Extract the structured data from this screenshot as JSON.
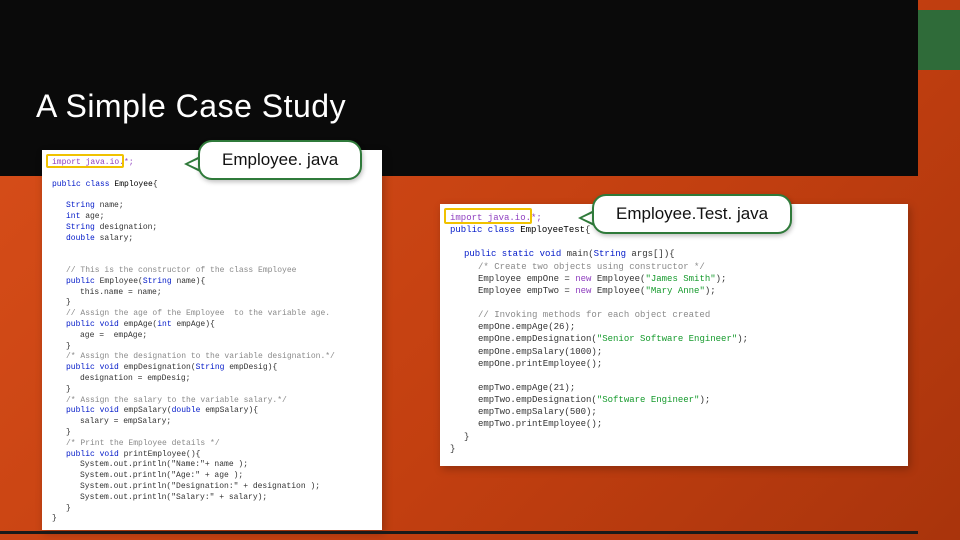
{
  "title": "A Simple Case Study",
  "callouts": {
    "left": "Employee. java",
    "right": "Employee.Test. java"
  },
  "code_left": {
    "import": "import java.io.*;",
    "class_decl": "public class Employee{",
    "fields": [
      "String name;",
      "int age;",
      "String designation;",
      "double salary;"
    ],
    "ctor_cm": "// This is the constructor of the class Employee",
    "ctor_sig": "public Employee(String name){",
    "ctor_body": "this.name = name;",
    "age_cm": "// Assign the age of the Employee  to the variable age.",
    "age_sig": "public void empAge(int empAge){",
    "age_body": "age =  empAge;",
    "desig_cm": "/* Assign the designation to the variable designation.*/",
    "desig_sig": "public void empDesignation(String empDesig){",
    "desig_body": "designation = empDesig;",
    "sal_cm": "/* Assign the salary to the variable salary.*/",
    "sal_sig": "public void empSalary(double empSalary){",
    "sal_body": "salary = empSalary;",
    "print_cm": "/* Print the Employee details */",
    "print_sig": "public void printEmployee(){",
    "p1": "System.out.println(\"Name:\"+ name );",
    "p2": "System.out.println(\"Age:\" + age );",
    "p3": "System.out.println(\"Designation:\" + designation );",
    "p4": "System.out.println(\"Salary:\" + salary);",
    "close": "}"
  },
  "code_right": {
    "import": "import java.io.*;",
    "class_decl": "public class EmployeeTest{",
    "main_sig": "public static void main(String args[]){",
    "cm1": "/* Create two objects using constructor */",
    "c1a": "Employee empOne = ",
    "c1b": "new",
    "c1c": " Employee(",
    "c1d": "\"James Smith\"",
    "c1e": ");",
    "c2a": "Employee empTwo = ",
    "c2b": "new",
    "c2c": " Employee(",
    "c2d": "\"Mary Anne\"",
    "c2e": ");",
    "cm2": "// Invoking methods for each object created",
    "m1": "empOne.empAge(26);",
    "m2a": "empOne.empDesignation(",
    "m2b": "\"Senior Software Engineer\"",
    "m2c": ");",
    "m3": "empOne.empSalary(1000);",
    "m4": "empOne.printEmployee();",
    "n1": "empTwo.empAge(21);",
    "n2a": "empTwo.empDesignation(",
    "n2b": "\"Software Engineer\"",
    "n2c": ");",
    "n3": "empTwo.empSalary(500);",
    "n4": "empTwo.printEmployee();"
  }
}
